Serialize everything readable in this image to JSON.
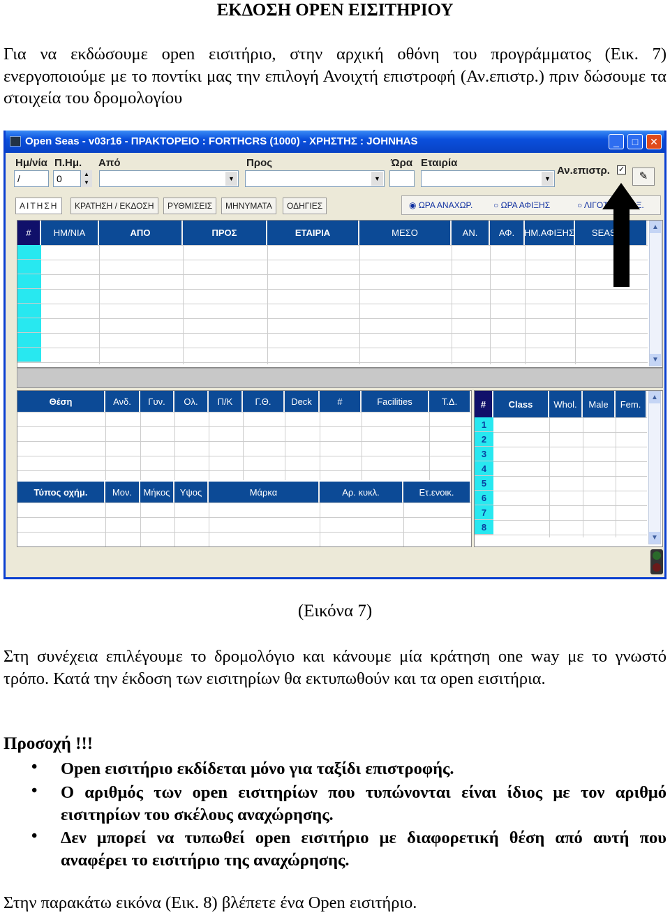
{
  "doc": {
    "title": "ΕΚΔΟΣΗ OPEN ΕΙΣΙΤΗΡΙΟΥ",
    "intro": "Για να εκδώσουμε open εισιτήριο, στην αρχική οθόνη του προγράμματος  (Εικ. 7) ενεργοποιούμε με το ποντίκι μας την επιλογή Ανοιχτή επιστροφή (Αν.επιστρ.) πριν δώσουμε τα στοιχεία του δρομολογίου",
    "caption": "(Εικόνα 7)",
    "para2": "Στη συνέχεια επιλέγουμε το δρομολόγιο και κάνουμε μία κράτηση one way με το γνωστό τρόπο. Κατά την έκδοση των εισιτηρίων θα εκτυπωθούν και τα open εισιτήρια.",
    "attention": "Προσοχή !!!",
    "bullets": [
      "Open εισιτήριο εκδίδεται μόνο για ταξίδι επιστροφής.",
      "Ο αριθμός των  open εισιτηρίων που τυπώνονται είναι ίδιος με τον αριθμό εισιτηρίων του σκέλους αναχώρησης.",
      "Δεν μπορεί να τυπωθεί open εισιτήριο με διαφορετική θέση από αυτή που αναφέρει το εισιτήριο της αναχώρησης."
    ],
    "closing": "Στην παρακάτω εικόνα  (Εικ. 8) βλέπετε ένα Open εισιτήριο."
  },
  "app": {
    "title": "Open Seas  - v03r16 - ΠΡΑΚΤΟΡΕΙΟ : FORTHCRS (1000) - ΧΡΗΣΤΗΣ : JOHNHAS",
    "labels": {
      "date": "Ημ/νία",
      "days": "Π.Ημ.",
      "from": "Από",
      "to": "Προς",
      "time": "Ώρα",
      "company": "Εταιρία",
      "open_return": "Αν.επιστρ."
    },
    "values": {
      "date": "/",
      "days": "0",
      "from": "",
      "to": "",
      "time": "",
      "company": "",
      "open_return_checked": true
    },
    "tabs": [
      "ΑΙΤΗΣΗ",
      "ΚΡΑΤΗΣΗ / ΕΚΔΟΣΗ",
      "ΡΥΘΜΙΣΕΙΣ",
      "ΜΗΝΥΜΑΤΑ",
      "ΟΔΗΓΙΕΣ"
    ],
    "sort_options": [
      "ΩΡΑ ΑΝΑΧΩΡ.",
      "ΩΡΑ ΑΦΙΞΗΣ",
      "ΛΙΓΟΤΕΡΑ ΤΑΞ."
    ],
    "sort_selected": "ΩΡΑ ΑΝΑΧΩΡ.",
    "routes_columns": [
      "#",
      "ΗΜ/ΝΙΑ",
      "ΑΠΟ",
      "ΠΡΟΣ",
      "ΕΤΑΙΡΙΑ",
      "ΜΕΣΟ",
      "ΑΝ.",
      "ΑΦ.",
      "ΗΜ.ΑΦΙΞΗΣ",
      "SEASON"
    ],
    "seats_columns": [
      "Θέση",
      "Ανδ.",
      "Γυν.",
      "Ολ.",
      "Π/Κ",
      "Γ.Θ.",
      "Deck",
      "#",
      "Facilities",
      "Τ.Δ."
    ],
    "vehicle_columns": [
      "Τύπος οχήμ.",
      "Μον.",
      "Μήκος",
      "Υψος",
      "Μάρκα",
      "Αρ. κυκλ.",
      "Ετ.ενοικ."
    ],
    "class_columns": [
      "#",
      "Class",
      "Whol.",
      "Male",
      "Fem."
    ],
    "class_rows": [
      "1",
      "2",
      "3",
      "4",
      "5",
      "6",
      "7",
      "8"
    ]
  },
  "colors": {
    "header": "#0c4a96",
    "row_marker": "#28e8f0",
    "titlebar": "#0a4fdc"
  }
}
